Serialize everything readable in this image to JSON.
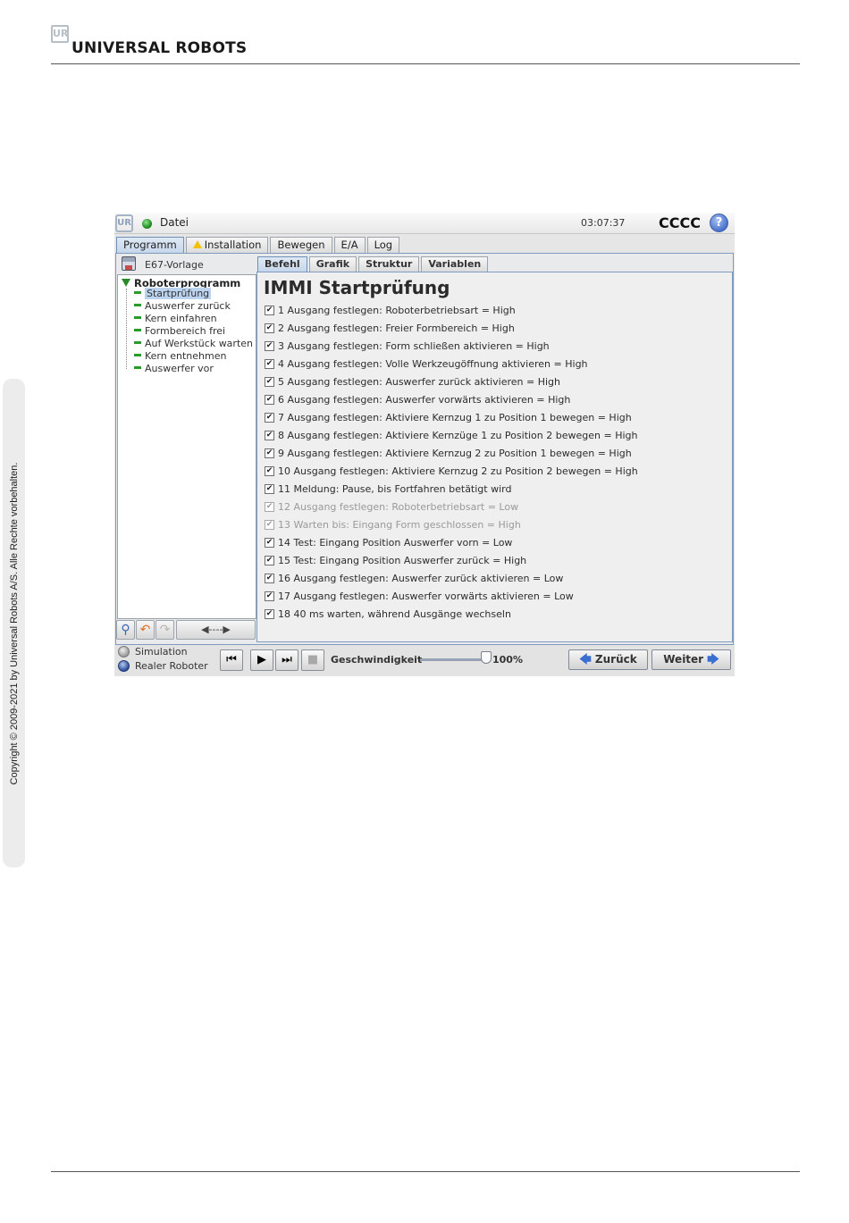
{
  "document": {
    "logo_mark": "UR",
    "brand": "UNIVERSAL ROBOTS",
    "copyright": "Copyright © 2009-2021 by Universal Robots A/S. Alle Rechte vorbehalten."
  },
  "app": {
    "logo_mark": "UR",
    "file_menu": "Datei",
    "clock": "03:07:37",
    "robot_name": "CCCC",
    "help_symbol": "?",
    "status_color": "#22a022"
  },
  "main_tabs": [
    "Programm",
    "Installation",
    "Bewegen",
    "E/A",
    "Log"
  ],
  "file_name": "E67-Vorlage",
  "tree": {
    "root": "Roboterprogramm",
    "items": [
      "Startprüfung",
      "Auswerfer zurück",
      "Kern einfahren",
      "Formbereich frei",
      "Auf Werkstück warten",
      "Kern entnehmen",
      "Auswerfer vor"
    ],
    "selected_index": 0,
    "move_button": "◀----▶"
  },
  "sub_tabs": [
    "Befehl",
    "Grafik",
    "Struktur",
    "Variablen"
  ],
  "panel": {
    "title": "IMMI Startprüfung",
    "check_mark": "✔",
    "commands": [
      {
        "text": "1 Ausgang festlegen: Roboterbetriebsart = High",
        "enabled": true
      },
      {
        "text": "2 Ausgang festlegen: Freier Formbereich = High",
        "enabled": true
      },
      {
        "text": "3 Ausgang festlegen: Form schließen aktivieren = High",
        "enabled": true
      },
      {
        "text": "4 Ausgang festlegen: Volle Werkzeugöffnung aktivieren = High",
        "enabled": true
      },
      {
        "text": "5 Ausgang festlegen: Auswerfer zurück aktivieren = High",
        "enabled": true
      },
      {
        "text": "6 Ausgang festlegen: Auswerfer vorwärts aktivieren = High",
        "enabled": true
      },
      {
        "text": "7 Ausgang festlegen: Aktiviere Kernzug 1 zu Position 1 bewegen = High",
        "enabled": true
      },
      {
        "text": "8 Ausgang festlegen: Aktiviere Kernzüge 1 zu Position 2 bewegen = High",
        "enabled": true
      },
      {
        "text": "9 Ausgang festlegen: Aktiviere Kernzug 2 zu Position 1 bewegen = High",
        "enabled": true
      },
      {
        "text": "10 Ausgang festlegen: Aktiviere Kernzug 2 zu Position 2 bewegen = High",
        "enabled": true
      },
      {
        "text": "11 Meldung: Pause, bis Fortfahren betätigt wird",
        "enabled": true
      },
      {
        "text": "12 Ausgang festlegen: Roboterbetriebsart = Low",
        "enabled": false
      },
      {
        "text": "13 Warten bis: Eingang Form geschlossen = High",
        "enabled": false
      },
      {
        "text": "14 Test: Eingang Position Auswerfer vorn = Low",
        "enabled": true
      },
      {
        "text": "15 Test: Eingang Position Auswerfer zurück = High",
        "enabled": true
      },
      {
        "text": "16 Ausgang festlegen: Auswerfer zurück aktivieren = Low",
        "enabled": true
      },
      {
        "text": "17 Ausgang festlegen: Auswerfer vorwärts aktivieren = Low",
        "enabled": true
      },
      {
        "text": "18 40 ms warten, während Ausgänge wechseln",
        "enabled": true
      }
    ]
  },
  "bottom": {
    "simulation_label": "Simulation",
    "real_robot_label": "Realer Roboter",
    "speed_label": "Geschwindigkeit",
    "speed_value": "100%",
    "speed_fraction": 1.0,
    "back_label": "Zurück",
    "next_label": "Weiter"
  }
}
